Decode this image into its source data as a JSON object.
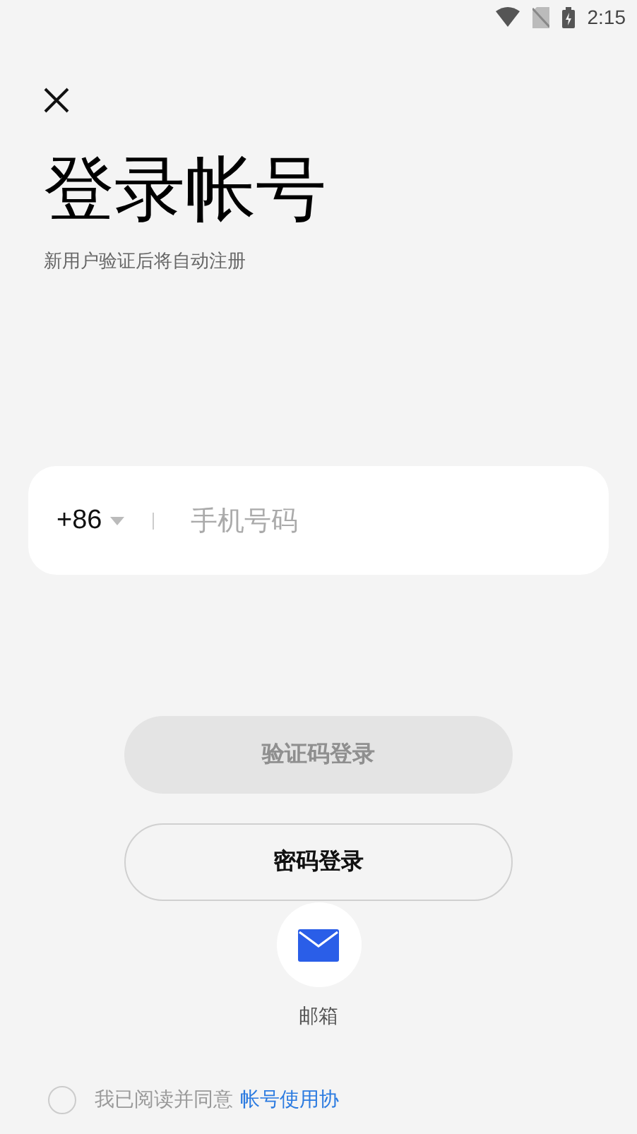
{
  "status_bar": {
    "time": "2:15"
  },
  "title": "登录帐号",
  "subtitle": "新用户验证后将自动注册",
  "phone_field": {
    "country_code": "+86",
    "placeholder": "手机号码"
  },
  "buttons": [
    {
      "label": "验证码登录",
      "kind": "filled",
      "disabled": true
    },
    {
      "label": "密码登录",
      "kind": "outline",
      "disabled": false
    }
  ],
  "alt_login": {
    "label": "邮箱"
  },
  "agreement": {
    "checked": false,
    "text": "我已阅读并同意",
    "link": "帐号使用协"
  }
}
